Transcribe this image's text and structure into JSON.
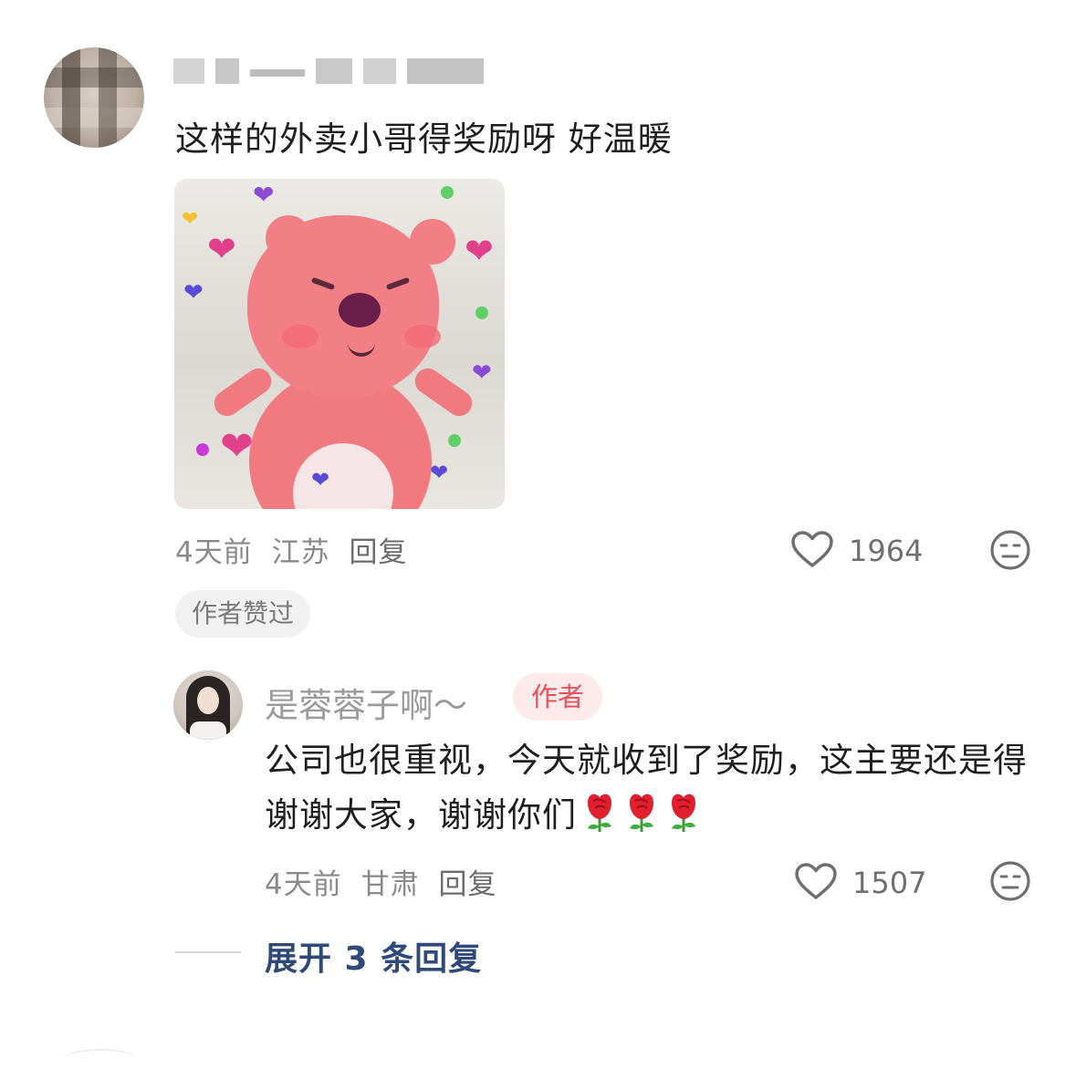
{
  "comment": {
    "avatar_icon": "avatar-blurred",
    "username_blurred": true,
    "text": "这样的外卖小哥得奖励呀 好温暖",
    "sticker_icon": "pink-beaver-hearts-sticker",
    "time": "4天前",
    "location": "江苏",
    "reply_label": "回复",
    "like_icon": "heart-outline-icon",
    "like_count": "1964",
    "reaction_icon": "meh-face-icon",
    "liked_badge": "作者赞过"
  },
  "reply": {
    "avatar_icon": "avatar-girl",
    "username": "是蓉蓉子啊～",
    "author_badge": "作者",
    "text": "公司也很重视，今天就收到了奖励，这主要还是得谢谢大家，谢谢你们",
    "emoji_icons": [
      "rose-icon",
      "rose-icon",
      "rose-icon"
    ],
    "time": "4天前",
    "location": "甘肃",
    "reply_label": "回复",
    "like_icon": "heart-outline-icon",
    "like_count": "1507",
    "reaction_icon": "meh-face-icon"
  },
  "expand": {
    "label": "展开 3 条回复"
  },
  "colors": {
    "author_badge_text": "#e8505b",
    "author_badge_bg": "#fdeaea",
    "expand_link": "#2f4a79",
    "meta_text": "#8a8a8a"
  }
}
